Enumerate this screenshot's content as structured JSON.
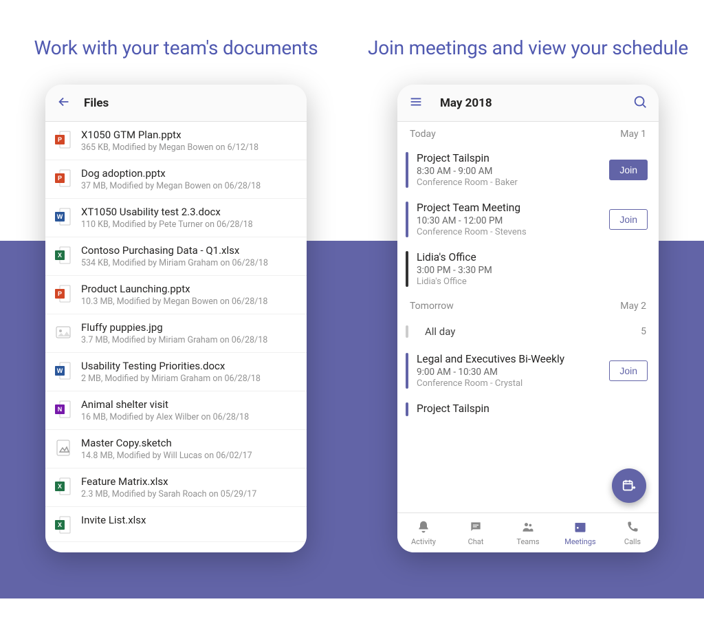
{
  "left": {
    "headline": "Work with your team's documents",
    "header_title": "Files",
    "files": [
      {
        "icon": "powerpoint",
        "name": "X1050 GTM Plan.pptx",
        "meta": "365 KB,  Modified by  Megan Bowen  on 6/12/18"
      },
      {
        "icon": "powerpoint",
        "name": "Dog adoption.pptx",
        "meta": "37 MB,  Modified by  Megan Bowen  on 06/28/18"
      },
      {
        "icon": "word",
        "name": "XT1050 Usability test 2.3.docx",
        "meta": "110 KB,  Modified by  Pete Turner  on 06/28/18"
      },
      {
        "icon": "excel",
        "name": "Contoso Purchasing Data - Q1.xlsx",
        "meta": "534 KB,  Modified by  Miriam Graham  on 06/28/18"
      },
      {
        "icon": "powerpoint",
        "name": "Product Launching.pptx",
        "meta": "10.3 MB,  Modified by  Megan Bowen  on 06/28/18"
      },
      {
        "icon": "image",
        "name": "Fluffy puppies.jpg",
        "meta": "3.7 MB,  Modified by  Miriam Graham  on 06/28/18"
      },
      {
        "icon": "word",
        "name": "Usability Testing Priorities.docx",
        "meta": "2 MB,  Modified by  Miriam Graham  on 06/28/18"
      },
      {
        "icon": "onenote",
        "name": "Animal shelter visit",
        "meta": "16 MB,  Modified by  Alex Wilber  on 06/28/18"
      },
      {
        "icon": "sketch",
        "name": "Master Copy.sketch",
        "meta": "14.8 MB,  Modified by  Will Lucas  on 06/02/17"
      },
      {
        "icon": "excel",
        "name": "Feature Matrix.xlsx",
        "meta": "2.3 MB,  Modified by  Sarah Roach  on 05/29/17"
      },
      {
        "icon": "excel",
        "name": "Invite List.xlsx",
        "meta": ""
      }
    ]
  },
  "right": {
    "headline": "Join meetings and view your schedule",
    "header_title": "May 2018",
    "sections": [
      {
        "label": "Today",
        "date": "May 1",
        "meetings": [
          {
            "bar": "purple",
            "title": "Project Tailspin",
            "time": "8:30 AM - 9:00 AM",
            "loc": "Conference Room - Baker",
            "join": "primary"
          },
          {
            "bar": "purple",
            "title": "Project Team Meeting",
            "time": "10:30 AM - 12:00 PM",
            "loc": "Conference Room - Stevens",
            "join": "outline"
          },
          {
            "bar": "dark",
            "title": "Lidia's Office",
            "time": "3:00 PM - 3:30 PM",
            "loc": "Lidia's Office",
            "join": "none"
          }
        ]
      },
      {
        "label": "Tomorrow",
        "date": "May 2",
        "allday": {
          "label": "All day",
          "count": "5"
        },
        "meetings": [
          {
            "bar": "purple",
            "title": "Legal and Executives Bi-Weekly",
            "time": "9:00 AM - 10:30 AM",
            "loc": "Conference Room - Crystal",
            "join": "outline"
          },
          {
            "bar": "purple",
            "title": "Project Tailspin",
            "time": "",
            "loc": "",
            "join": "none"
          }
        ]
      }
    ],
    "join_label": "Join",
    "nav": [
      {
        "key": "activity",
        "label": "Activity"
      },
      {
        "key": "chat",
        "label": "Chat"
      },
      {
        "key": "teams",
        "label": "Teams"
      },
      {
        "key": "meetings",
        "label": "Meetings"
      },
      {
        "key": "calls",
        "label": "Calls"
      }
    ],
    "nav_active": "meetings"
  }
}
